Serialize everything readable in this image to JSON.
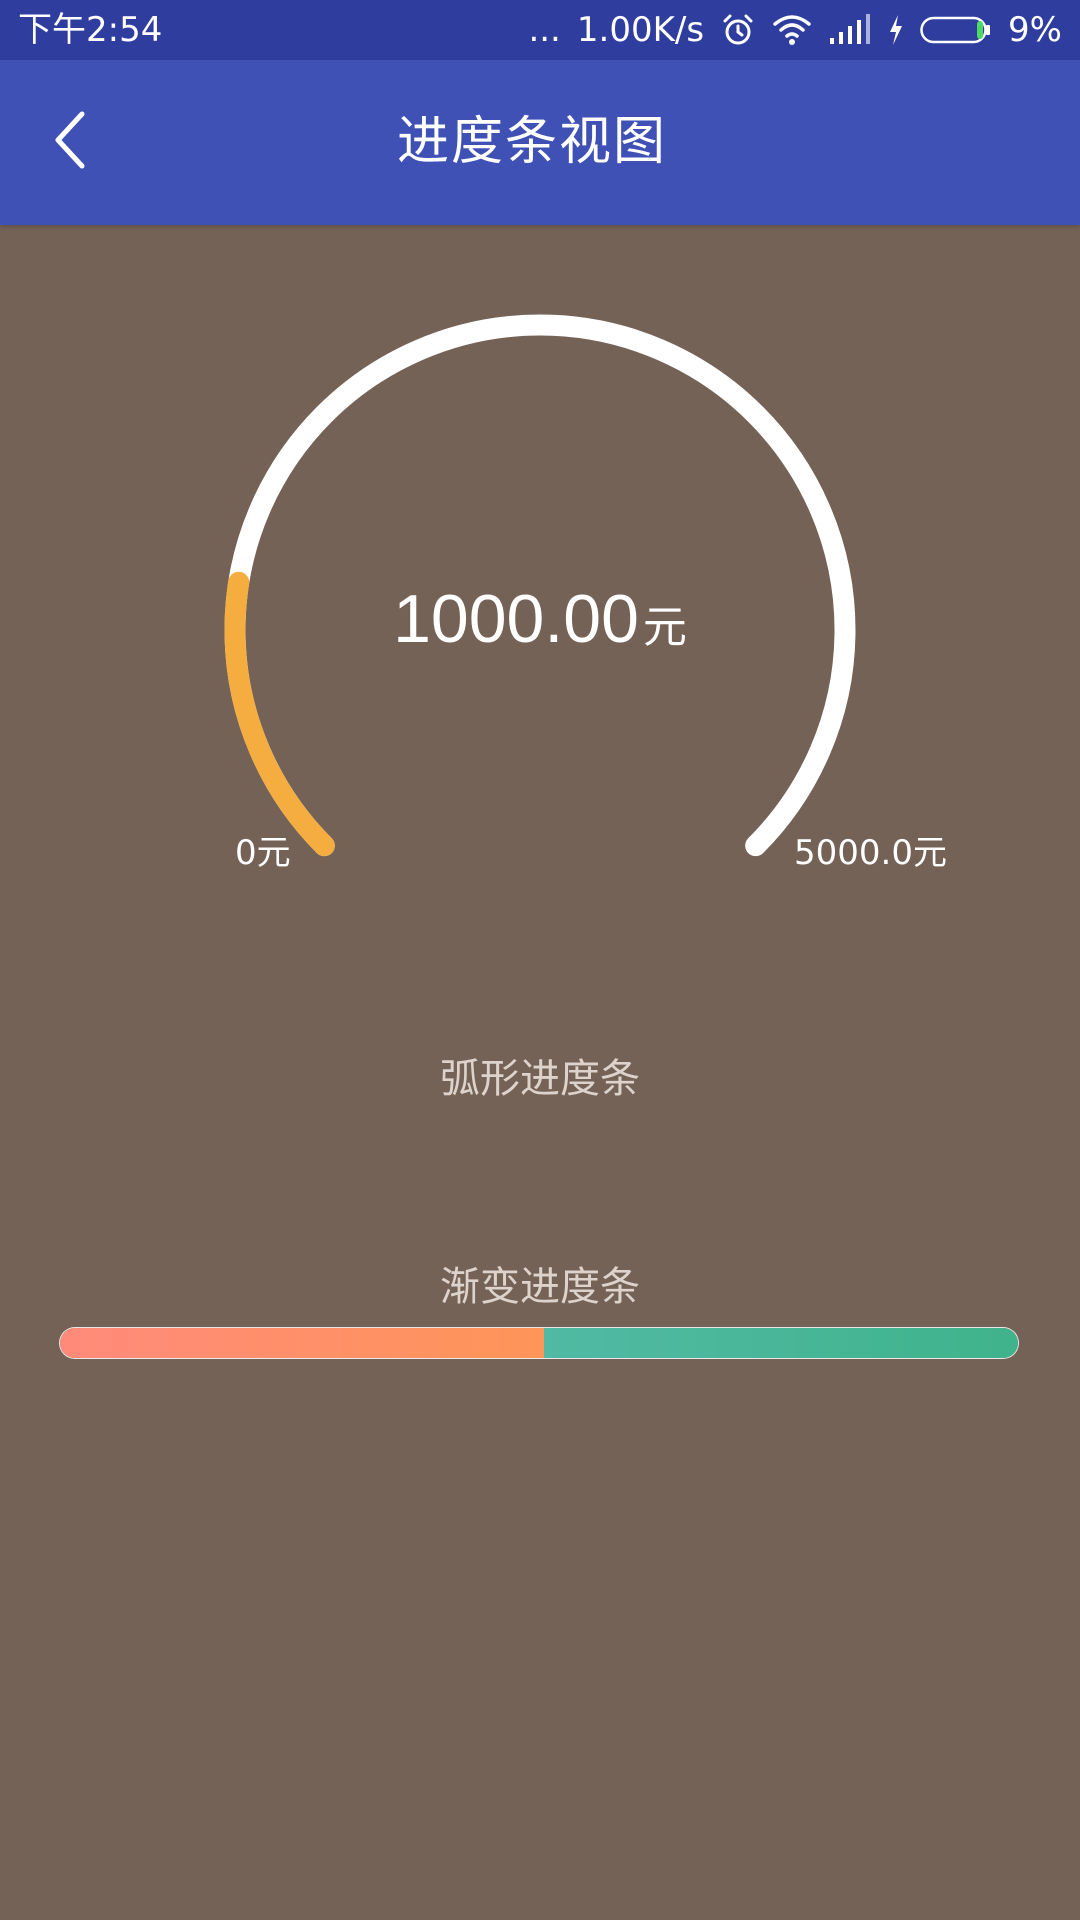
{
  "status_bar": {
    "time": "下午2:54",
    "dots": "...",
    "network_speed": "1.00K/s",
    "battery_percent": "9%",
    "icons": [
      "alarm-icon",
      "wifi-icon",
      "signal-icon",
      "charging-icon",
      "battery-icon"
    ]
  },
  "app_bar": {
    "title": "进度条视图",
    "back_icon": "chevron-left-icon"
  },
  "arc_progress": {
    "value_text": "1000.00",
    "unit": "元",
    "value": 1000,
    "min_label": "0元",
    "max_label": "5000.0元",
    "min": 0,
    "max": 5000,
    "caption": "弧形进度条",
    "colors": {
      "track": "#ffffff",
      "progress": "#f5ad3f"
    }
  },
  "gradient_progress": {
    "caption": "渐变进度条",
    "progress": 0.505,
    "colors": {
      "fill_start": "#ff8a7b",
      "fill_end": "#ff9558",
      "remaining_start": "#64c0bd",
      "remaining_end": "#3fb38b"
    }
  },
  "colors": {
    "status_bar": "#2f3e9e",
    "app_bar": "#3f51b5",
    "background": "#756257"
  }
}
